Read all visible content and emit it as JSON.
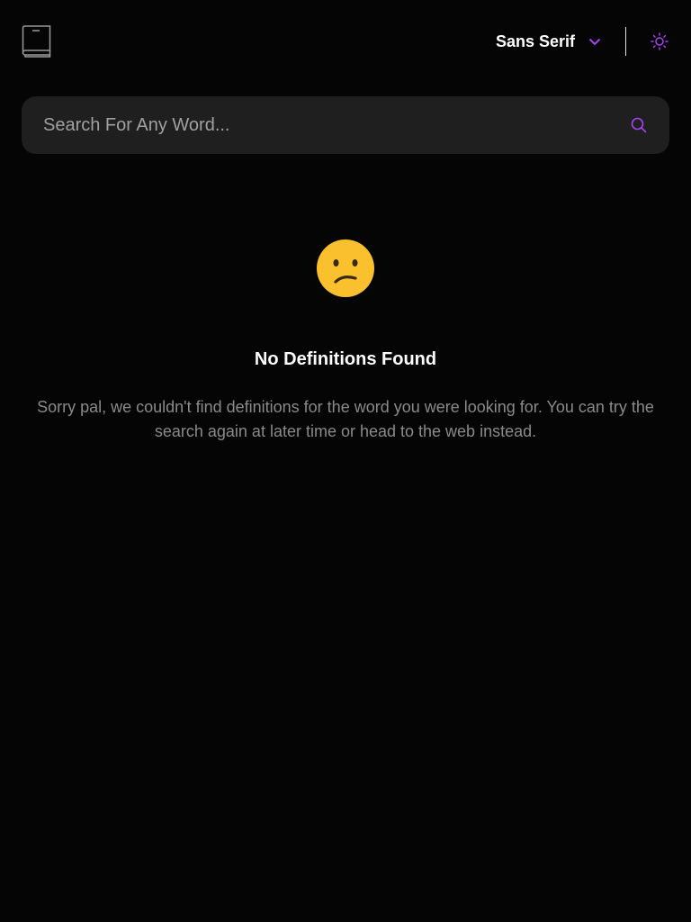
{
  "header": {
    "logo_icon": "book-icon",
    "font_select": {
      "selected": "Sans Serif",
      "icon": "chevron-down-icon"
    },
    "theme_toggle": {
      "icon": "sun-icon"
    }
  },
  "search": {
    "placeholder": "Search For Any Word...",
    "value": "",
    "icon": "search-icon"
  },
  "empty_state": {
    "emoji": "confused-face-icon",
    "title": "No Definitions Found",
    "message": "Sorry pal, we couldn't find definitions for the word you were looking for. You can try the search again at later time or head to the web instead."
  },
  "colors": {
    "background": "#050505",
    "accent": "#a445ed",
    "search_bg": "#1f1f1f",
    "muted_text": "#8a8a8a",
    "emoji_yellow": "#fbc02d"
  }
}
